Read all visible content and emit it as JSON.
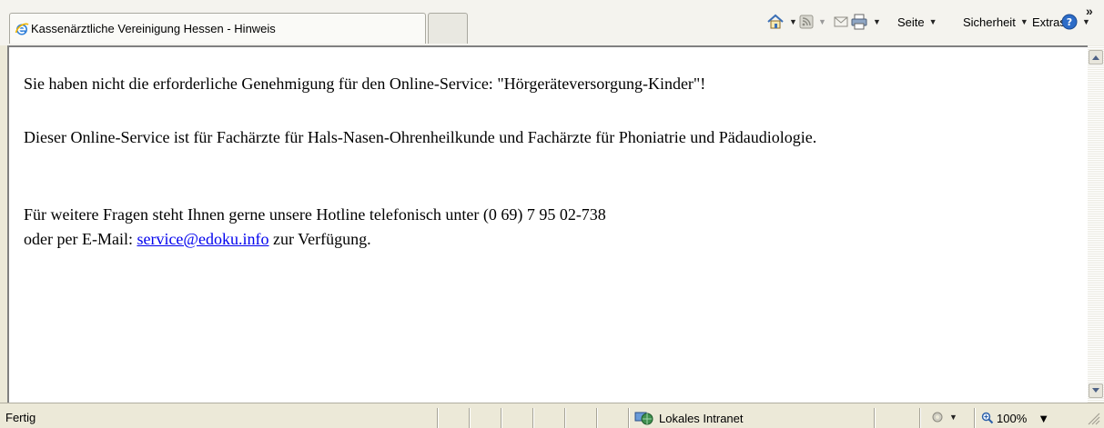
{
  "tab": {
    "title": "Kassenärztliche Vereinigung Hessen - Hinweis"
  },
  "commandbar": {
    "home_icon": "home-icon",
    "feeds_icon": "rss-feed-icon",
    "mail_icon": "mail-icon",
    "print_icon": "printer-icon",
    "page_label": "Seite",
    "security_label": "Sicherheit",
    "tools_label": "Extras",
    "help_icon": "help-icon",
    "overflow": "»"
  },
  "content": {
    "line1": "Sie haben nicht die erforderliche Genehmigung für den Online-Service: \"Hörgeräteversorgung-Kinder\"!",
    "line2": "Dieser Online-Service ist für Fachärzte für Hals-Nasen-Ohrenheilkunde und Fachärzte für Phoniatrie und Pädaudiologie.",
    "line3": "Für weitere Fragen steht Ihnen gerne unsere Hotline telefonisch unter (0 69) 7 95 02-738",
    "line4_prefix": "oder per E-Mail:",
    "email_link": "service@edoku.info",
    "line4_suffix": "zur Verfügung."
  },
  "statusbar": {
    "status_text": "Fertig",
    "zone_label": "Lokales Intranet",
    "zoom_label": "100%"
  },
  "colors": {
    "link": "#0000ee",
    "chrome": "#ece9d8"
  }
}
